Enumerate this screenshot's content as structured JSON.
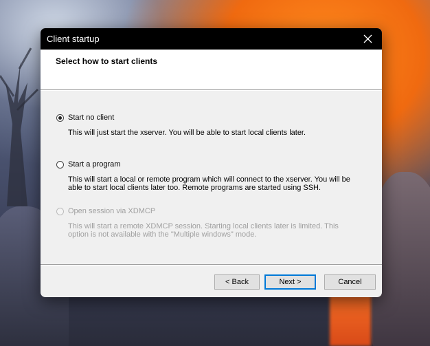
{
  "window": {
    "title": "Client startup"
  },
  "header": {
    "title": "Select how to start clients"
  },
  "options": [
    {
      "label": "Start no client",
      "description": "This will just start the xserver. You will be able to start local clients later.",
      "checked": true,
      "enabled": true
    },
    {
      "label": "Start a program",
      "description": "This will start a local or remote program which will connect to the xserver. You will be able to start local clients later too. Remote programs are started using SSH.",
      "checked": false,
      "enabled": true
    },
    {
      "label": "Open session via XDMCP",
      "description": "This will start a remote XDMCP session. Starting local clients later is limited. This option is not available with the \"Multiple windows\" mode.",
      "checked": false,
      "enabled": false
    }
  ],
  "buttons": {
    "back": "< Back",
    "next": "Next >",
    "cancel": "Cancel"
  },
  "icons": {
    "close": "close-icon"
  }
}
